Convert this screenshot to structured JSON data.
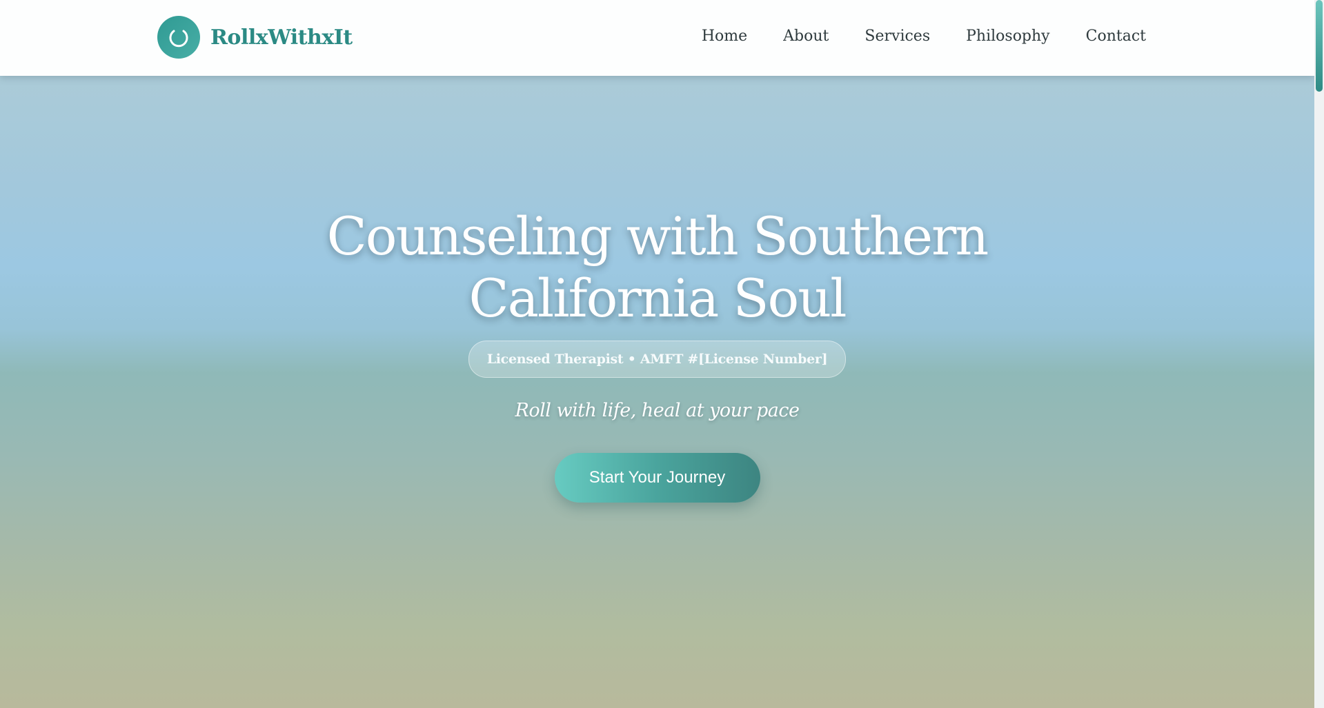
{
  "brand": {
    "name": "RollxWithxIt",
    "logo_icon": "spinner-circle-icon"
  },
  "nav": {
    "items": [
      {
        "label": "Home"
      },
      {
        "label": "About"
      },
      {
        "label": "Services"
      },
      {
        "label": "Philosophy"
      },
      {
        "label": "Contact"
      }
    ]
  },
  "hero": {
    "title_line1": "Counseling with Southern",
    "title_line2": "California Soul",
    "badge": "Licensed Therapist • AMFT #[License Number]",
    "tagline": "Roll with life, heal at your pace",
    "cta_label": "Start Your Journey"
  },
  "colors": {
    "brand": "#2b8a84",
    "accent": "#4aa49d"
  }
}
